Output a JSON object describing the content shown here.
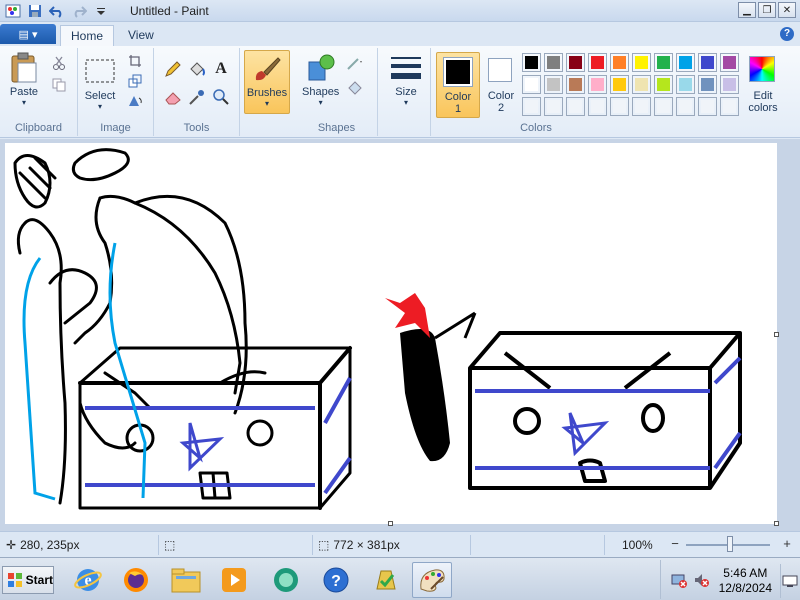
{
  "window": {
    "title": "Untitled - Paint"
  },
  "tabs": {
    "app_menu": "▤ ▾",
    "home": "Home",
    "view": "View"
  },
  "ribbon": {
    "clipboard": {
      "label": "Clipboard",
      "paste": "Paste"
    },
    "image": {
      "label": "Image",
      "select": "Select"
    },
    "tools": {
      "label": "Tools"
    },
    "brushes": "Brushes",
    "shapes": {
      "label": "Shapes",
      "button": "Shapes"
    },
    "size": "Size",
    "colors": {
      "label": "Colors",
      "color1": "Color 1",
      "color1_line1": "Color",
      "color1_line2": "1",
      "color2_line1": "Color",
      "color2_line2": "2",
      "edit_line1": "Edit",
      "edit_line2": "colors",
      "color1_value": "#000000",
      "color2_value": "#ffffff",
      "palette_row1": [
        "#000000",
        "#7f7f7f",
        "#880015",
        "#ed1c24",
        "#ff7f27",
        "#fff200",
        "#22b14c",
        "#00a2e8",
        "#3f48cc",
        "#a349a4"
      ],
      "palette_row2": [
        "#ffffff",
        "#c3c3c3",
        "#b97a57",
        "#ffaec9",
        "#ffc90e",
        "#efe4b0",
        "#b5e61d",
        "#99d9ea",
        "#7092be",
        "#c8bfe7"
      ]
    }
  },
  "status": {
    "cursor_pos": "280, 235px",
    "canvas_size": "772 × 381px",
    "zoom": "100%"
  },
  "taskbar": {
    "start": "Start",
    "time": "5:46 AM",
    "date": "12/8/2024"
  }
}
